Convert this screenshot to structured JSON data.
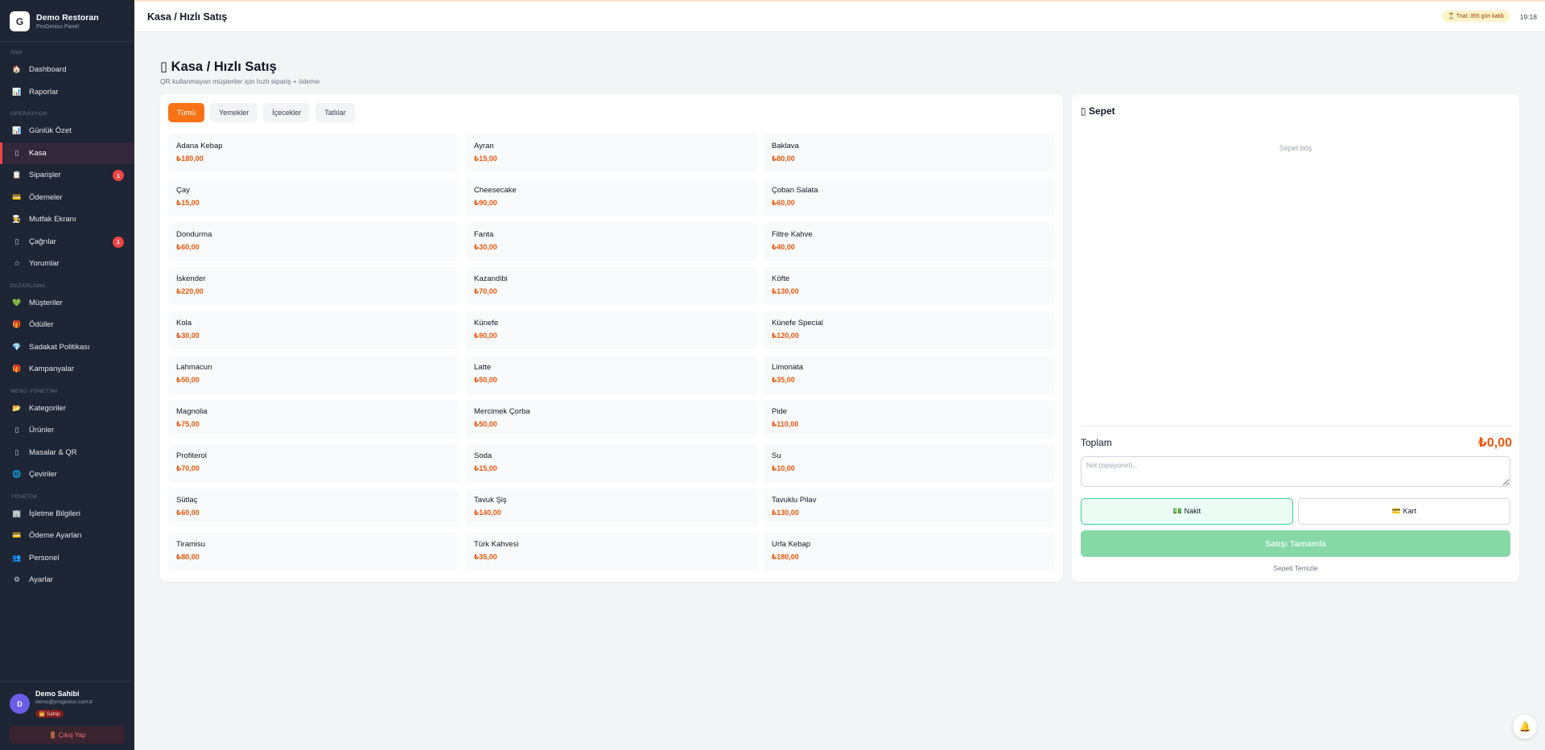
{
  "brand": {
    "name": "Demo Restoran",
    "subtitle": "ProGenius Panel"
  },
  "sidebar": {
    "sections": [
      {
        "title": "ANA",
        "items": [
          {
            "icon": "🏠",
            "icon_name": "home-icon",
            "label": "Dashboard"
          },
          {
            "icon": "📊",
            "icon_name": "reports-icon",
            "label": "Raporlar"
          }
        ]
      },
      {
        "title": "OPERASYON",
        "items": [
          {
            "icon": "📊",
            "icon_name": "summary-icon",
            "label": "Günlük Özet"
          },
          {
            "icon": "▯",
            "icon_name": "register-icon",
            "label": "Kasa",
            "active": true
          },
          {
            "icon": "📋",
            "icon_name": "orders-icon",
            "label": "Siparişler",
            "badge": "1"
          },
          {
            "icon": "💳",
            "icon_name": "payments-icon",
            "label": "Ödemeler"
          },
          {
            "icon": "👨‍🍳",
            "icon_name": "kitchen-icon",
            "label": "Mutfak Ekranı"
          },
          {
            "icon": "▯",
            "icon_name": "calls-icon",
            "label": "Çağrılar",
            "badge": "1"
          },
          {
            "icon": "☆",
            "icon_name": "star-icon",
            "label": "Yorumlar"
          }
        ]
      },
      {
        "title": "PAZARLAMA",
        "items": [
          {
            "icon": "💚",
            "icon_name": "customers-icon",
            "label": "Müşteriler"
          },
          {
            "icon": "🎁",
            "icon_name": "rewards-icon",
            "label": "Ödüller"
          },
          {
            "icon": "💎",
            "icon_name": "loyalty-icon",
            "label": "Sadakat Politikası"
          },
          {
            "icon": "🎁",
            "icon_name": "campaigns-icon",
            "label": "Kampanyalar"
          }
        ]
      },
      {
        "title": "MENÜ YÖNETİMİ",
        "items": [
          {
            "icon": "📂",
            "icon_name": "categories-icon",
            "label": "Kategoriler"
          },
          {
            "icon": "▯",
            "icon_name": "products-icon",
            "label": "Ürünler"
          },
          {
            "icon": "▯",
            "icon_name": "tables-qr-icon",
            "label": "Masalar & QR"
          },
          {
            "icon": "🌐",
            "icon_name": "translations-icon",
            "label": "Çeviriler"
          }
        ]
      },
      {
        "title": "YÖNETİM",
        "items": [
          {
            "icon": "🏢",
            "icon_name": "business-icon",
            "label": "İşletme Bilgileri"
          },
          {
            "icon": "💳",
            "icon_name": "payment-settings-icon",
            "label": "Ödeme Ayarları"
          },
          {
            "icon": "👥",
            "icon_name": "staff-icon",
            "label": "Personel"
          },
          {
            "icon": "⚙",
            "icon_name": "gear-icon",
            "label": "Ayarlar"
          }
        ]
      }
    ]
  },
  "user": {
    "initial": "D",
    "name": "Demo Sahibi",
    "email": "demo@progenius.com.tr",
    "role": "👑 Sahip",
    "logout": "🚪 Çıkış Yap"
  },
  "topbar": {
    "title": "Kasa / Hızlı Satış",
    "trial": "⏳ Trial: 355 gün kaldı",
    "time": "19:18"
  },
  "page": {
    "title": "▯ Kasa / Hızlı Satış",
    "subtitle": "QR kullanmayan müşteriler için hızlı sipariş + ödeme"
  },
  "tabs": [
    {
      "label": "Tümü",
      "active": true
    },
    {
      "label": "Yemekler"
    },
    {
      "label": "İçecekler"
    },
    {
      "label": "Tatlılar"
    }
  ],
  "products": [
    {
      "name": "Adana Kebap",
      "price": "₺180,00"
    },
    {
      "name": "Ayran",
      "price": "₺15,00"
    },
    {
      "name": "Baklava",
      "price": "₺80,00"
    },
    {
      "name": "Çay",
      "price": "₺15,00"
    },
    {
      "name": "Cheesecake",
      "price": "₺90,00"
    },
    {
      "name": "Çoban Salata",
      "price": "₺60,00"
    },
    {
      "name": "Dondurma",
      "price": "₺60,00"
    },
    {
      "name": "Fanta",
      "price": "₺30,00"
    },
    {
      "name": "Filtre Kahve",
      "price": "₺40,00"
    },
    {
      "name": "İskender",
      "price": "₺220,00"
    },
    {
      "name": "Kazandibi",
      "price": "₺70,00"
    },
    {
      "name": "Köfte",
      "price": "₺130,00"
    },
    {
      "name": "Kola",
      "price": "₺30,00"
    },
    {
      "name": "Künefe",
      "price": "₺90,00"
    },
    {
      "name": "Künefe Special",
      "price": "₺120,00"
    },
    {
      "name": "Lahmacun",
      "price": "₺50,00"
    },
    {
      "name": "Latte",
      "price": "₺50,00"
    },
    {
      "name": "Limonata",
      "price": "₺35,00"
    },
    {
      "name": "Magnolia",
      "price": "₺75,00"
    },
    {
      "name": "Mercimek Çorba",
      "price": "₺50,00"
    },
    {
      "name": "Pide",
      "price": "₺110,00"
    },
    {
      "name": "Profiterol",
      "price": "₺70,00"
    },
    {
      "name": "Soda",
      "price": "₺15,00"
    },
    {
      "name": "Su",
      "price": "₺10,00"
    },
    {
      "name": "Sütlaç",
      "price": "₺60,00"
    },
    {
      "name": "Tavuk Şiş",
      "price": "₺140,00"
    },
    {
      "name": "Tavuklu Pilav",
      "price": "₺130,00"
    },
    {
      "name": "Tiramisu",
      "price": "₺80,00"
    },
    {
      "name": "Türk Kahvesi",
      "price": "₺35,00"
    },
    {
      "name": "Urfa Kebap",
      "price": "₺180,00"
    }
  ],
  "cart": {
    "title": "▯ Sepet",
    "empty": "Sepet boş",
    "total_label": "Toplam",
    "total_value": "₺0,00",
    "note_placeholder": "Not (opsiyonel)...",
    "cash_label": "💵 Nakit",
    "card_label": "💳 Kart",
    "complete_label": "Satışı Tamamla",
    "clear_label": "Sepeti Temizle"
  },
  "colors": {
    "accent": "#f97316",
    "price": "#ea580c",
    "sidebar": "#1e2535",
    "badge": "#ef4444",
    "complete": "#86d9a5"
  }
}
